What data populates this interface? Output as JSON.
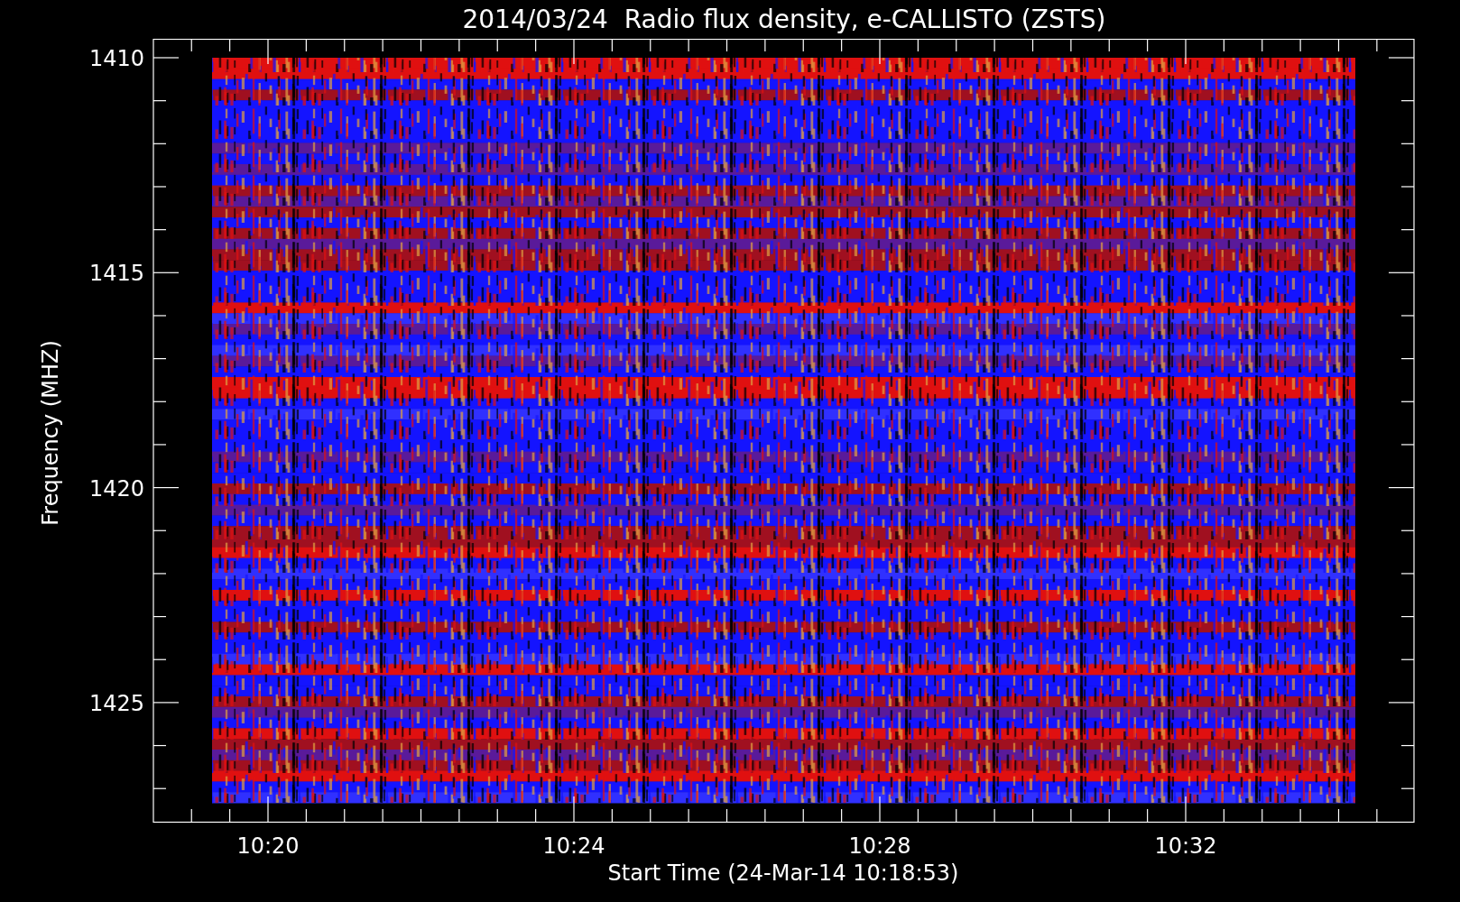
{
  "title": "2014/03/24  Radio flux density, e-CALLISTO (ZSTS)",
  "plot": {
    "ylabel": "Frequency (MHZ)",
    "xlabel": "Start Time (24-Mar-14 10:18:53)",
    "yticks": [
      {
        "label": "1410"
      },
      {
        "label": "1415"
      },
      {
        "label": "1420"
      },
      {
        "label": "1425"
      }
    ],
    "xticks": [
      {
        "label": "10:20"
      },
      {
        "label": "10:24"
      },
      {
        "label": "10:28"
      },
      {
        "label": "10:32"
      }
    ]
  }
}
